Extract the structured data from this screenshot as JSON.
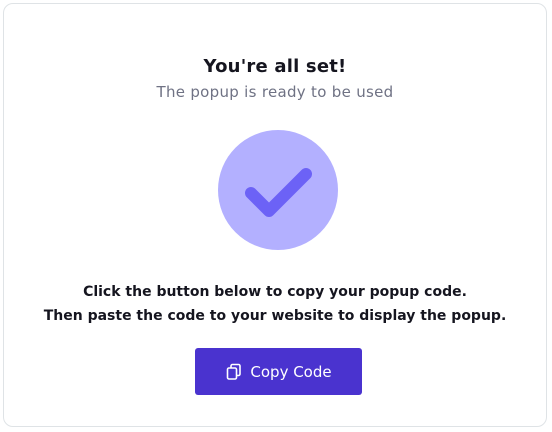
{
  "dialog": {
    "title": "You're all set!",
    "subtitle": "The popup is ready to be used",
    "instruction_line1": "Click the button below to copy your popup code.",
    "instruction_line2": "Then paste the code to your website to display the popup.",
    "copy_button_label": "Copy Code"
  },
  "icons": {
    "status": "checkmark-icon",
    "copy": "copy-icon"
  },
  "colors": {
    "accent": "#4a33cf",
    "check_circle": "#b3b0ff",
    "check_mark": "#6c62f6",
    "border": "#dfe3e6"
  }
}
